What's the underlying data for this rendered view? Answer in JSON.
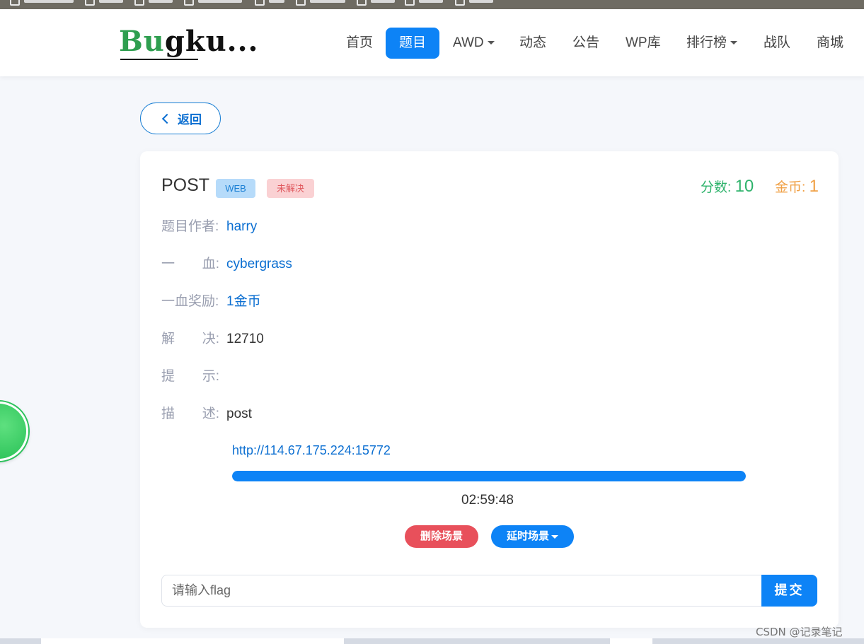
{
  "nav": {
    "logo_green": "Bu",
    "logo_black": "gku...",
    "items": [
      {
        "label": "首页",
        "active": false,
        "dropdown": false
      },
      {
        "label": "题目",
        "active": true,
        "dropdown": false
      },
      {
        "label": "AWD",
        "active": false,
        "dropdown": true
      },
      {
        "label": "动态",
        "active": false,
        "dropdown": false
      },
      {
        "label": "公告",
        "active": false,
        "dropdown": false
      },
      {
        "label": "WP库",
        "active": false,
        "dropdown": false
      },
      {
        "label": "排行榜",
        "active": false,
        "dropdown": true
      },
      {
        "label": "战队",
        "active": false,
        "dropdown": false
      },
      {
        "label": "商城",
        "active": false,
        "dropdown": false
      }
    ]
  },
  "back_label": "返回",
  "challenge": {
    "title": "POST",
    "category_badge": "WEB",
    "status_badge": "未解决",
    "score_label": "分数:",
    "score_value": "10",
    "coin_label": "金币:",
    "coin_value": "1",
    "author_label": "题目作者:",
    "author": "harry",
    "first_blood_label_a": "一",
    "first_blood_label_b": "血:",
    "first_blood": "cybergrass",
    "reward_label": "一血奖励:",
    "reward": "1金币",
    "solves_label_a": "解",
    "solves_label_b": "决:",
    "solves": "12710",
    "hint_label_a": "提",
    "hint_label_b": "示:",
    "hint": "",
    "desc_label_a": "描",
    "desc_label_b": "述:",
    "description": "post"
  },
  "scene": {
    "url": "http://114.67.175.224:15772",
    "remaining_fraction": 1.0,
    "timer": "02:59:48",
    "delete_label": "删除场景",
    "extend_label": "延时场景"
  },
  "flag": {
    "placeholder": "请输入flag",
    "submit_label": "提交"
  },
  "watermark": "CSDN @记录笔记",
  "colors": {
    "primary": "#0d83f6",
    "score": "#2fb36c",
    "coin": "#f0a045",
    "danger": "#e8505b"
  }
}
